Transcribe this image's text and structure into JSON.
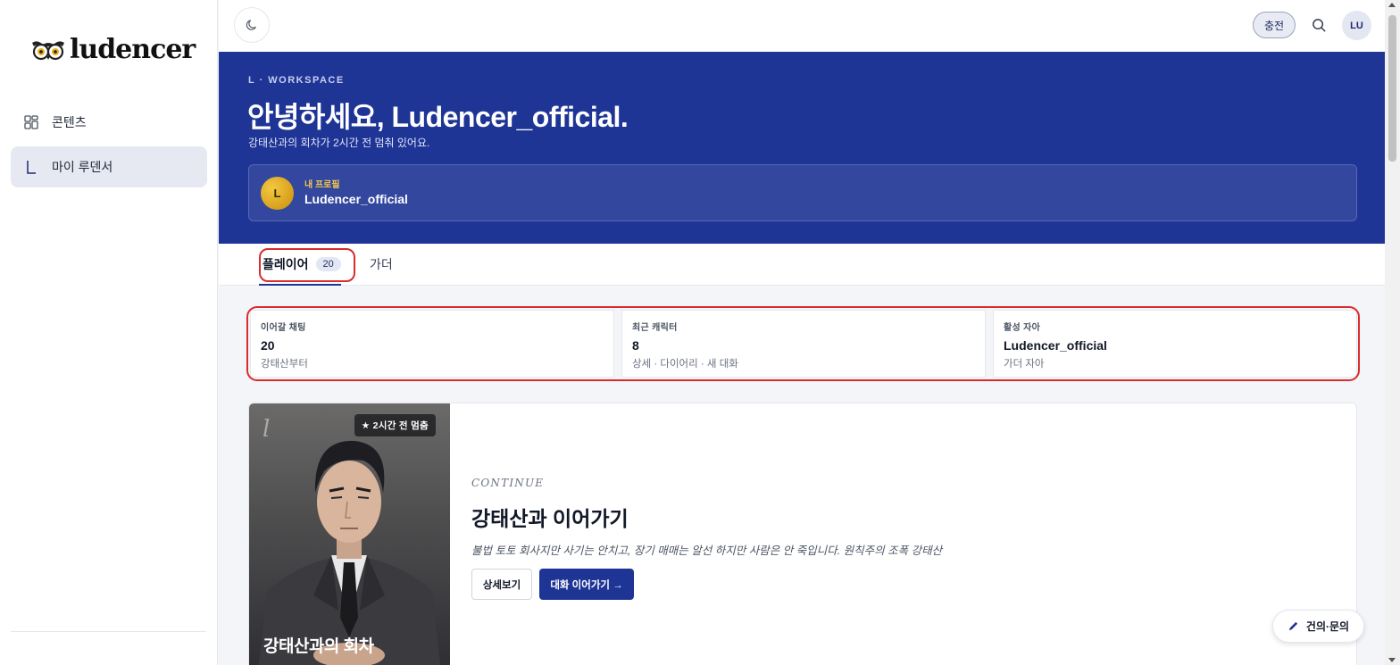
{
  "brand": {
    "logo_text": "ludencer"
  },
  "sidebar": {
    "items": [
      {
        "label": "콘텐츠",
        "icon": "grid-icon",
        "active": false
      },
      {
        "label": "마이 루덴서",
        "icon": "l-letter-icon",
        "active": true
      }
    ]
  },
  "topbar": {
    "theme_icon": "moon-icon",
    "charge_label": "충전",
    "search_icon": "search-icon",
    "avatar_initials": "LU"
  },
  "hero": {
    "eyebrow": "L · WORKSPACE",
    "greeting": "안녕하세요, Ludencer_official.",
    "subline": "강태산과의 회차가 2시간 전 멈춰 있어요.",
    "profile": {
      "avatar_initial": "L",
      "label": "내 프로필",
      "name": "Ludencer_official"
    },
    "background_color": "#1f3596"
  },
  "tabs": [
    {
      "label": "플레이어",
      "count": "20",
      "active": true
    },
    {
      "label": "가더",
      "active": false
    }
  ],
  "stats": [
    {
      "label": "이어갈 채팅",
      "value": "20",
      "sub": "강태산부터"
    },
    {
      "label": "최근 캐릭터",
      "value": "8",
      "sub": "상세 · 다이어리 · 새 대화"
    },
    {
      "label": "활성 자아",
      "value": "Ludencer_official",
      "sub": "가더 자아"
    }
  ],
  "continue_card": {
    "cover_badge": "★ 2시간 전 멈춤",
    "cover_mark": "l",
    "cover_title": "강태산과의 회차",
    "eyebrow": "CONTINUE",
    "title": "강태산과 이어가기",
    "description": "불법 토토 회사지만 사기는 안치고, 장기 매매는 알선 하지만 사람은 안 죽입니다. 원칙주의 조폭 강태산",
    "detail_button": "상세보기",
    "continue_button": "대화 이어가기 →"
  },
  "fab": {
    "label": "건의·문의",
    "icon": "pencil-icon"
  },
  "annotations": {
    "highlight_color": "#d92c2c"
  }
}
